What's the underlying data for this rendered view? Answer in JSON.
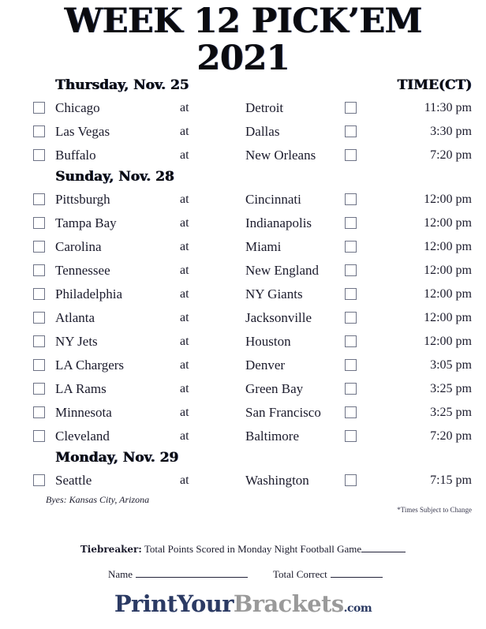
{
  "title": {
    "line1": "WEEK 12 PICK’EM",
    "line2": "2021"
  },
  "time_header": "TIME(CT)",
  "at_label": "at",
  "sections": [
    {
      "day": "Thursday, Nov. 25",
      "games": [
        {
          "home": "Chicago",
          "at": "at",
          "away": "Detroit",
          "time": "11:30 pm"
        },
        {
          "home": "Las Vegas",
          "at": "at",
          "away": "Dallas",
          "time": "3:30 pm"
        },
        {
          "home": "Buffalo",
          "at": "at",
          "away": "New Orleans",
          "time": "7:20 pm"
        }
      ]
    },
    {
      "day": "Sunday, Nov. 28",
      "games": [
        {
          "home": "Pittsburgh",
          "at": "at",
          "away": "Cincinnati",
          "time": "12:00 pm"
        },
        {
          "home": "Tampa Bay",
          "at": "at",
          "away": "Indianapolis",
          "time": "12:00 pm"
        },
        {
          "home": "Carolina",
          "at": "at",
          "away": "Miami",
          "time": "12:00 pm"
        },
        {
          "home": "Tennessee",
          "at": "at",
          "away": "New England",
          "time": "12:00 pm"
        },
        {
          "home": "Philadelphia",
          "at": "at",
          "away": "NY Giants",
          "time": "12:00 pm"
        },
        {
          "home": "Atlanta",
          "at": "at",
          "away": "Jacksonville",
          "time": "12:00 pm"
        },
        {
          "home": "NY Jets",
          "at": "at",
          "away": "Houston",
          "time": "12:00 pm"
        },
        {
          "home": "LA Chargers",
          "at": "at",
          "away": "Denver",
          "time": "3:05 pm"
        },
        {
          "home": "LA Rams",
          "at": "at",
          "away": "Green Bay",
          "time": "3:25 pm"
        },
        {
          "home": "Minnesota",
          "at": "at",
          "away": "San Francisco",
          "time": "3:25 pm"
        },
        {
          "home": "Cleveland",
          "at": "at",
          "away": "Baltimore",
          "time": "7:20 pm"
        }
      ]
    },
    {
      "day": "Monday, Nov. 29",
      "games": [
        {
          "home": "Seattle",
          "at": "at",
          "away": "Washington",
          "time": "7:15 pm"
        }
      ]
    }
  ],
  "notes": {
    "byes": "Byes: Kansas City, Arizona",
    "times_disclaimer": "*Times Subject to Change"
  },
  "tiebreaker": {
    "label": "Tiebreaker:",
    "text": "Total Points Scored in Monday Night Football Game"
  },
  "footer": {
    "name_label": "Name",
    "total_correct_label": "Total Correct"
  },
  "logo": {
    "part1": "PrintYour",
    "part2": "Brackets",
    "part3": ".com",
    "color1": "#2b3a63",
    "color2": "#9a9a9a"
  }
}
